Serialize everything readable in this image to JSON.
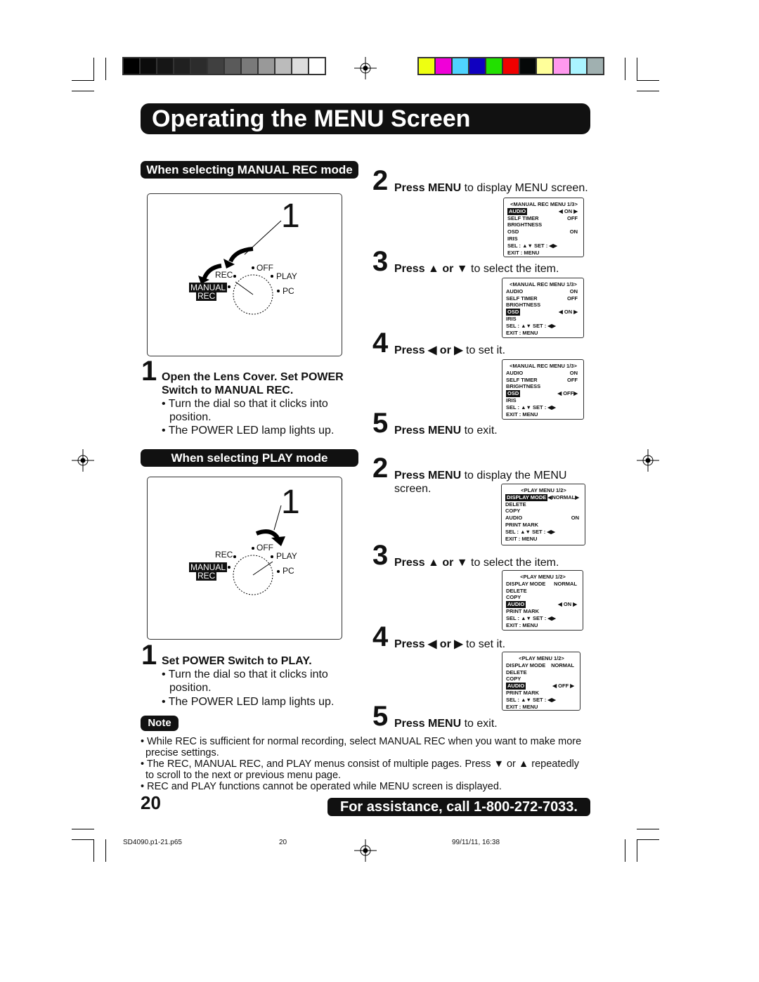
{
  "registration": {
    "gray_bars": [
      "#000000",
      "#0b0b0b",
      "#161616",
      "#202020",
      "#2c2c2c",
      "#404040",
      "#5a5a5a",
      "#7a7a7a",
      "#999999",
      "#bbbbbb",
      "#dddddd",
      "#ffffff"
    ],
    "color_bars": [
      "#eeff11",
      "#f000d8",
      "#4fd3ff",
      "#1000c0",
      "#22e000",
      "#f00000",
      "#050808",
      "#ffff9a",
      "#ff99ee",
      "#aaf4ff",
      "#a0b0b0"
    ]
  },
  "title": "Operating the MENU Screen",
  "manual": {
    "header": "When selecting MANUAL REC mode",
    "dial": {
      "number": "1",
      "off": "OFF",
      "rec": "REC",
      "play": "PLAY",
      "manual": "MANUAL",
      "rec2": "REC",
      "pc": "PC"
    },
    "step1": {
      "num": "1",
      "bold": "Open the Lens Cover. Set POWER Switch to MANUAL REC.",
      "bullets": [
        "• Turn the dial so that it clicks into position.",
        "• The POWER LED lamp lights up."
      ]
    },
    "steps": [
      {
        "num": "2",
        "bold": "Press MENU",
        "rest": " to display MENU screen."
      },
      {
        "num": "3",
        "bold": "Press ▲ or ▼",
        "rest": " to select the item."
      },
      {
        "num": "4",
        "bold": "Press ◀ or ▶",
        "rest": " to set it."
      },
      {
        "num": "5",
        "bold": "Press MENU",
        "rest": " to exit."
      }
    ],
    "menus": [
      {
        "title": "<MANUAL REC MENU 1/3>",
        "rows": [
          [
            "AUDIO",
            "◀ ON ▶",
            true
          ],
          [
            "SELF TIMER",
            "OFF",
            false
          ],
          [
            "BRIGHTNESS",
            "",
            false
          ],
          [
            "OSD",
            "ON",
            false
          ],
          [
            "IRIS",
            "",
            false
          ],
          [
            "SEL   : ▲▼      SET   : ◀▶",
            "",
            false
          ],
          [
            "EXIT  : MENU",
            "",
            false
          ]
        ]
      },
      {
        "title": "<MANUAL REC MENU 1/3>",
        "rows": [
          [
            "AUDIO",
            "ON",
            false
          ],
          [
            "SELF TIMER",
            "OFF",
            false
          ],
          [
            "BRIGHTNESS",
            "",
            false
          ],
          [
            "OSD",
            "◀ ON ▶",
            true
          ],
          [
            "IRIS",
            "",
            false
          ],
          [
            "SEL   : ▲▼      SET   : ◀▶",
            "",
            false
          ],
          [
            "EXIT  : MENU",
            "",
            false
          ]
        ]
      },
      {
        "title": "<MANUAL REC MENU 1/3>",
        "rows": [
          [
            "AUDIO",
            "ON",
            false
          ],
          [
            "SELF TIMER",
            "OFF",
            false
          ],
          [
            "BRIGHTNESS",
            "",
            false
          ],
          [
            "OSD",
            "◀ OFF▶",
            true
          ],
          [
            "IRIS",
            "",
            false
          ],
          [
            "SEL   : ▲▼      SET   : ◀▶",
            "",
            false
          ],
          [
            "EXIT  : MENU",
            "",
            false
          ]
        ]
      }
    ]
  },
  "play": {
    "header": "When selecting PLAY mode",
    "dial": {
      "number": "1",
      "off": "OFF",
      "rec": "REC",
      "play": "PLAY",
      "manual": "MANUAL",
      "rec2": "REC",
      "pc": "PC"
    },
    "step1": {
      "num": "1",
      "bold": "Set POWER Switch to PLAY.",
      "bullets": [
        "• Turn the dial so that it clicks into position.",
        "• The POWER LED lamp lights up."
      ]
    },
    "steps": [
      {
        "num": "2",
        "bold": "Press MENU",
        "rest": " to display the MENU screen."
      },
      {
        "num": "3",
        "bold": "Press ▲ or ▼",
        "rest": " to select the item."
      },
      {
        "num": "4",
        "bold": "Press ◀ or ▶",
        "rest": " to set it."
      },
      {
        "num": "5",
        "bold": "Press MENU",
        "rest": " to exit."
      }
    ],
    "menus": [
      {
        "title": "<PLAY MENU 1/2>",
        "rows": [
          [
            "DISPLAY MODE",
            "◀NORMAL▶",
            true
          ],
          [
            "DELETE",
            "",
            false
          ],
          [
            "COPY",
            "",
            false
          ],
          [
            "AUDIO",
            "ON",
            false
          ],
          [
            "PRINT MARK",
            "",
            false
          ],
          [
            "SEL   : ▲▼      SET   : ◀▶",
            "",
            false
          ],
          [
            "EXIT  : MENU",
            "",
            false
          ]
        ]
      },
      {
        "title": "<PLAY MENU 1/2>",
        "rows": [
          [
            "DISPLAY MODE",
            "NORMAL",
            false
          ],
          [
            "DELETE",
            "",
            false
          ],
          [
            "COPY",
            "",
            false
          ],
          [
            "AUDIO",
            "◀ ON ▶",
            true
          ],
          [
            "PRINT MARK",
            "",
            false
          ],
          [
            "SEL   : ▲▼      SET   : ◀▶",
            "",
            false
          ],
          [
            "EXIT  : MENU",
            "",
            false
          ]
        ]
      },
      {
        "title": "<PLAY MENU 1/2>",
        "rows": [
          [
            "DISPLAY MODE",
            "NORMAL",
            false
          ],
          [
            "DELETE",
            "",
            false
          ],
          [
            "COPY",
            "",
            false
          ],
          [
            "AUDIO",
            "◀ OFF ▶",
            true
          ],
          [
            "PRINT MARK",
            "",
            false
          ],
          [
            "SEL   : ▲▼      SET   : ◀▶",
            "",
            false
          ],
          [
            "EXIT  : MENU",
            "",
            false
          ]
        ]
      }
    ]
  },
  "note": {
    "label": "Note",
    "items": [
      "• While REC is sufficient for normal recording, select MANUAL REC when you want to make more precise settings.",
      "• The REC, MANUAL REC, and PLAY menus consist of multiple pages. Press ▼ or ▲ repeatedly to scroll to the next or previous menu page.",
      "• REC and PLAY functions cannot be operated while MENU screen is displayed."
    ]
  },
  "page_number": "20",
  "assistance": "For assistance, call 1-800-272-7033.",
  "footer": {
    "file": "SD4090.p1-21.p65",
    "page": "20",
    "date": "99/11/11, 16:38"
  }
}
